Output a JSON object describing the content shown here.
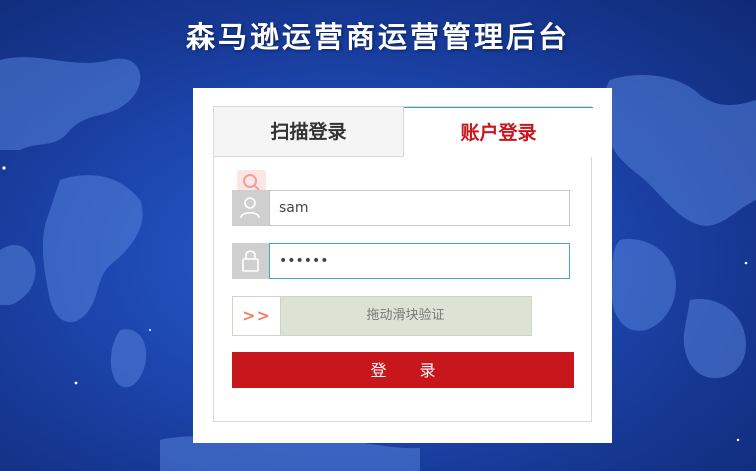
{
  "header": {
    "title": "森马逊运营商运营管理后台"
  },
  "tabs": [
    {
      "label": "扫描登录",
      "active": false
    },
    {
      "label": "账户登录",
      "active": true
    }
  ],
  "form": {
    "username": {
      "value": "sam",
      "icon": "user-icon"
    },
    "password": {
      "value": "......",
      "icon": "lock-icon"
    },
    "slider": {
      "handle_label": ">>",
      "text": "拖动滑块验证"
    },
    "submit_label": "登 录"
  },
  "colors": {
    "accent": "#c8161d",
    "background": "#1d47b0",
    "slider_bg": "#dde3d4"
  }
}
